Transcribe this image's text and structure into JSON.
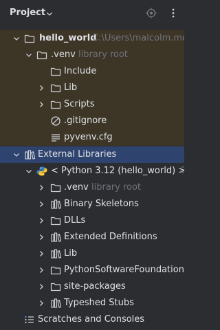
{
  "header": {
    "title": "Project",
    "chevron_icon": "chevron-down-icon",
    "locate_icon": "target-icon",
    "more_icon": "more-vertical-icon"
  },
  "tree": [
    {
      "label": "hello_world",
      "hint": "C:\\Users\\malcolm.mck",
      "icon": "folder-icon",
      "expanded": true,
      "bold": true
    },
    {
      "label": ".venv",
      "hint": "library root",
      "icon": "folder-icon",
      "expanded": true
    },
    {
      "label": "Include",
      "icon": "folder-icon"
    },
    {
      "label": "Lib",
      "icon": "folder-icon",
      "expanded": false
    },
    {
      "label": "Scripts",
      "icon": "folder-icon",
      "expanded": false
    },
    {
      "label": ".gitignore",
      "icon": "ignored-file-icon"
    },
    {
      "label": "pyvenv.cfg",
      "icon": "config-file-icon"
    },
    {
      "label": "External Libraries",
      "icon": "library-icon",
      "expanded": true
    },
    {
      "label": "< Python 3.12 (hello_world) >",
      "hint": "C",
      "icon": "python-icon",
      "expanded": true
    },
    {
      "label": ".venv",
      "hint": "library root",
      "icon": "folder-icon",
      "expanded": false
    },
    {
      "label": "Binary Skeletons",
      "icon": "library-icon",
      "expanded": false
    },
    {
      "label": "DLLs",
      "icon": "folder-icon",
      "expanded": false
    },
    {
      "label": "Extended Definitions",
      "icon": "library-icon",
      "expanded": false
    },
    {
      "label": "Lib",
      "icon": "library-icon",
      "expanded": false
    },
    {
      "label": "PythonSoftwareFoundation.",
      "icon": "folder-icon",
      "expanded": false
    },
    {
      "label": "site-packages",
      "icon": "folder-icon",
      "expanded": false
    },
    {
      "label": "Typeshed Stubs",
      "icon": "library-icon",
      "expanded": false
    },
    {
      "label": "Scratches and Consoles",
      "icon": "scratches-icon"
    }
  ],
  "colors": {
    "background": "#2b2d30",
    "venv_highlight": "#3d3526",
    "selection": "#2e436e",
    "text": "#dfe1e5",
    "hint": "#6f737a"
  }
}
